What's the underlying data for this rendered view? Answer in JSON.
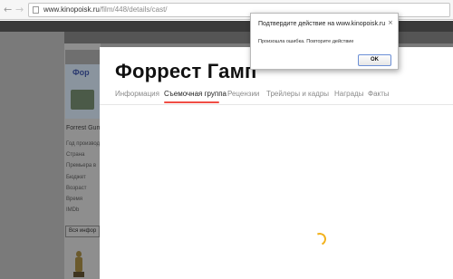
{
  "browser": {
    "url_host": "www.kinopoisk.ru",
    "url_path": "/film/448/details/cast/"
  },
  "background_site": {
    "poster_title": "Фор",
    "film_title_short": "Forrest Gum",
    "info_labels": [
      "Год производ",
      "Страна",
      "Премьера в",
      "Бюджет",
      "Возраст",
      "Время",
      "IMDb"
    ],
    "more_info_button": "Вся инфор"
  },
  "panel": {
    "film_title": "Форрест Гамп",
    "tabs": [
      {
        "label": "Информация",
        "active": false
      },
      {
        "label": "Съемочная группа",
        "active": true
      },
      {
        "label": "Рецензии",
        "active": false
      },
      {
        "label": "Трейлеры и кадры",
        "active": false
      },
      {
        "label": "Награды",
        "active": false
      },
      {
        "label": "Факты",
        "active": false
      }
    ],
    "accent_color": "#f04e45",
    "spinner_color": "#f2b21d"
  },
  "dialog": {
    "title": "Подтвердите действие на www.kinopoisk.ru",
    "message": "Произошла ошибка. Повторите действие",
    "ok_label": "OK",
    "close_icon": "close-icon"
  }
}
